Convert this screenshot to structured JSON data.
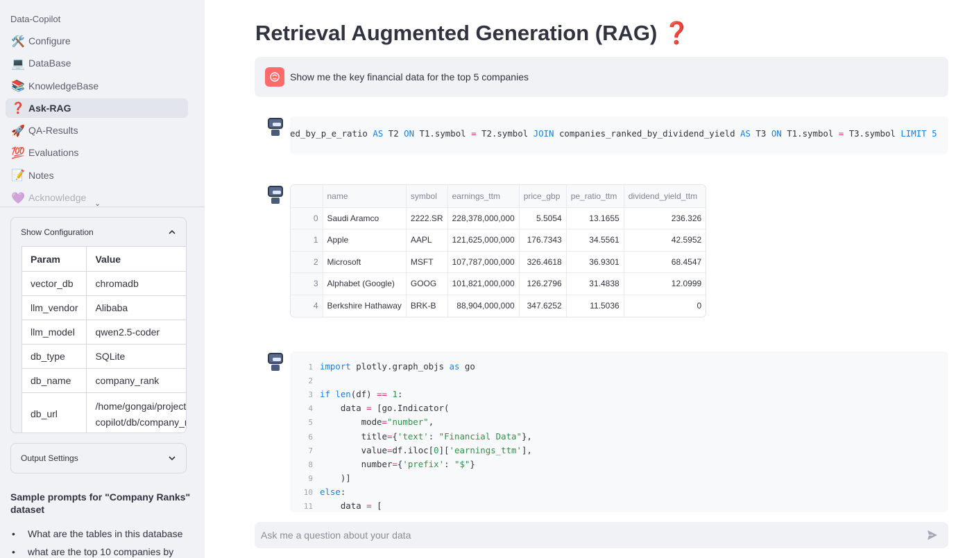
{
  "sidebar": {
    "app_name": "Data-Copilot",
    "nav": [
      {
        "icon": "🛠️",
        "label": "Configure"
      },
      {
        "icon": "💻",
        "label": "DataBase"
      },
      {
        "icon": "📚",
        "label": "KnowledgeBase"
      },
      {
        "icon": "❓",
        "label": "Ask-RAG"
      },
      {
        "icon": "🚀",
        "label": "QA-Results"
      },
      {
        "icon": "💯",
        "label": "Evaluations"
      },
      {
        "icon": "📝",
        "label": "Notes"
      },
      {
        "icon": "💜",
        "label": "Acknowledge"
      }
    ],
    "config_expander": {
      "label": "Show Configuration",
      "headers": [
        "Param",
        "Value"
      ],
      "rows": [
        [
          "vector_db",
          "chromadb"
        ],
        [
          "llm_vendor",
          "Alibaba"
        ],
        [
          "llm_model",
          "qwen2.5-coder"
        ],
        [
          "db_type",
          "SQLite"
        ],
        [
          "db_name",
          "company_rank"
        ],
        [
          "db_url",
          "/home/gongai/projects/go",
          "copilot/db/company_rank"
        ]
      ]
    },
    "output_expander": {
      "label": "Output Settings"
    },
    "sample_title": "Sample prompts for \"Company Ranks\" dataset",
    "samples": [
      "What are the tables in this database",
      "what are the top 10 companies by"
    ]
  },
  "main": {
    "title": "Retrieval Augmented Generation (RAG)",
    "title_emoji": "❓",
    "user_question": "Show me the key financial data for the top 5 companies",
    "sql_tail": "ed_by_p_e_ratio AS T2 ON T1.symbol = T2.symbol JOIN companies_ranked_by_dividend_yield AS T3 ON T1.symbol = T3.symbol LIMIT 5",
    "table": {
      "columns": [
        "",
        "name",
        "symbol",
        "earnings_ttm",
        "price_gbp",
        "pe_ratio_ttm",
        "dividend_yield_ttm"
      ],
      "rows": [
        [
          "0",
          "Saudi Aramco",
          "2222.SR",
          "228,378,000,000",
          "5.5054",
          "13.1655",
          "236.326"
        ],
        [
          "1",
          "Apple",
          "AAPL",
          "121,625,000,000",
          "176.7343",
          "34.5561",
          "42.5952"
        ],
        [
          "2",
          "Microsoft",
          "MSFT",
          "107,787,000,000",
          "326.4618",
          "36.9301",
          "68.4547"
        ],
        [
          "3",
          "Alphabet (Google)",
          "GOOG",
          "101,821,000,000",
          "126.2796",
          "31.4838",
          "12.0999"
        ],
        [
          "4",
          "Berkshire Hathaway",
          "BRK-B",
          "88,904,000,000",
          "347.6252",
          "11.5036",
          "0"
        ]
      ]
    },
    "code_lines": [
      "import plotly.graph_objs as go",
      "",
      "if len(df) == 1:",
      "    data = [go.Indicator(",
      "        mode=\"number\",",
      "        title={'text': \"Financial Data\"},",
      "        value=df.iloc[0]['earnings_ttm'],",
      "        number={'prefix': \"$\"}",
      "    )]",
      "else:",
      "    data = ["
    ],
    "chat_placeholder": "Ask me a question about your data"
  }
}
